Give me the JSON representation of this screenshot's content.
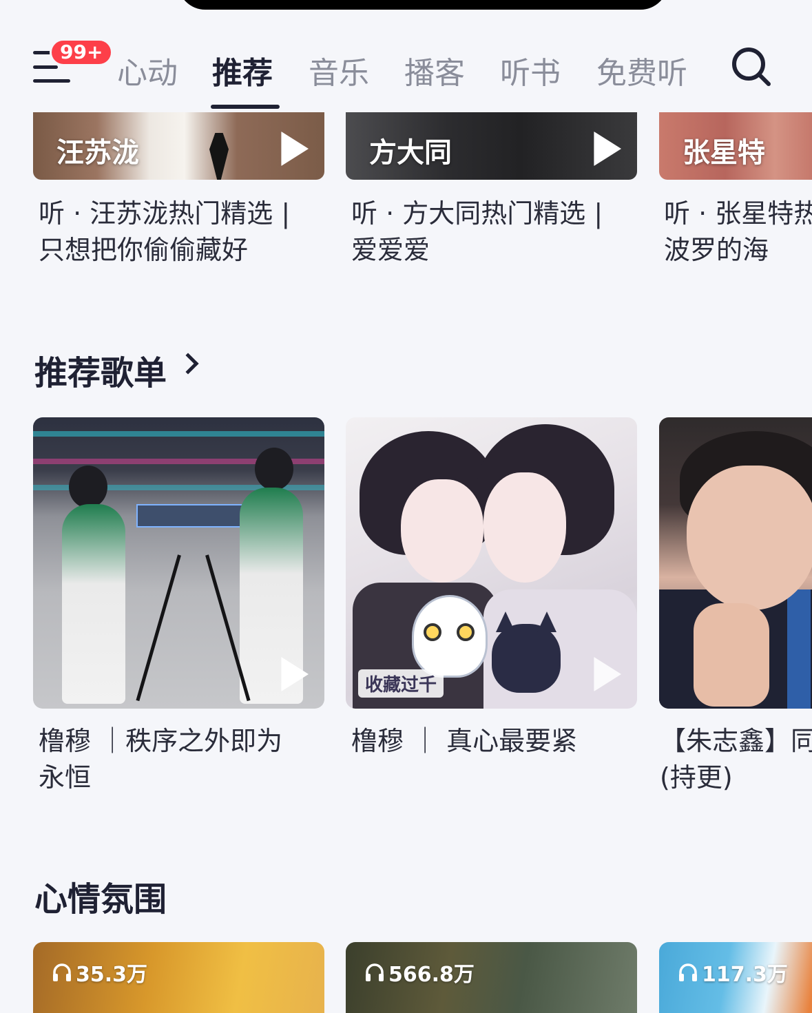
{
  "header": {
    "badge": "99+",
    "tabs": [
      {
        "label": "心动"
      },
      {
        "label": "推荐"
      },
      {
        "label": "音乐"
      },
      {
        "label": "播客"
      },
      {
        "label": "听书"
      },
      {
        "label": "免费听"
      }
    ],
    "active_tab": "推荐",
    "icons": {
      "menu": "menu-icon",
      "search": "search-icon"
    }
  },
  "artist_row": [
    {
      "name": "汪苏泷",
      "title_line1": "听 · 汪苏泷热门精选 |",
      "title_line2": "只想把你偷偷藏好"
    },
    {
      "name": "方大同",
      "title_line1": "听 · 方大同热门精选 |",
      "title_line2": "爱爱爱"
    },
    {
      "name": "张星特",
      "title_line1": "听 · 张星特热",
      "title_line2": "波罗的海"
    }
  ],
  "playlists": {
    "heading": "推荐歌单",
    "items": [
      {
        "title_line1": "橹穆 ｜秩序之外即为",
        "title_line2": "永恒"
      },
      {
        "title_line1": "橹穆 ｜ 真心最要紧",
        "title_line2": "",
        "tag": "收藏过千"
      },
      {
        "title_line1": "【朱志鑫】同",
        "title_line2": "(持更)"
      }
    ]
  },
  "mood": {
    "heading": "心情氛围",
    "items": [
      {
        "plays": "35.3万"
      },
      {
        "plays": "566.8万"
      },
      {
        "plays": "117.3万"
      }
    ]
  },
  "colors": {
    "background": "#f5f6fa",
    "text_primary": "#1f2133",
    "text_inactive": "#8a8d9a",
    "badge": "#fd3f49"
  }
}
